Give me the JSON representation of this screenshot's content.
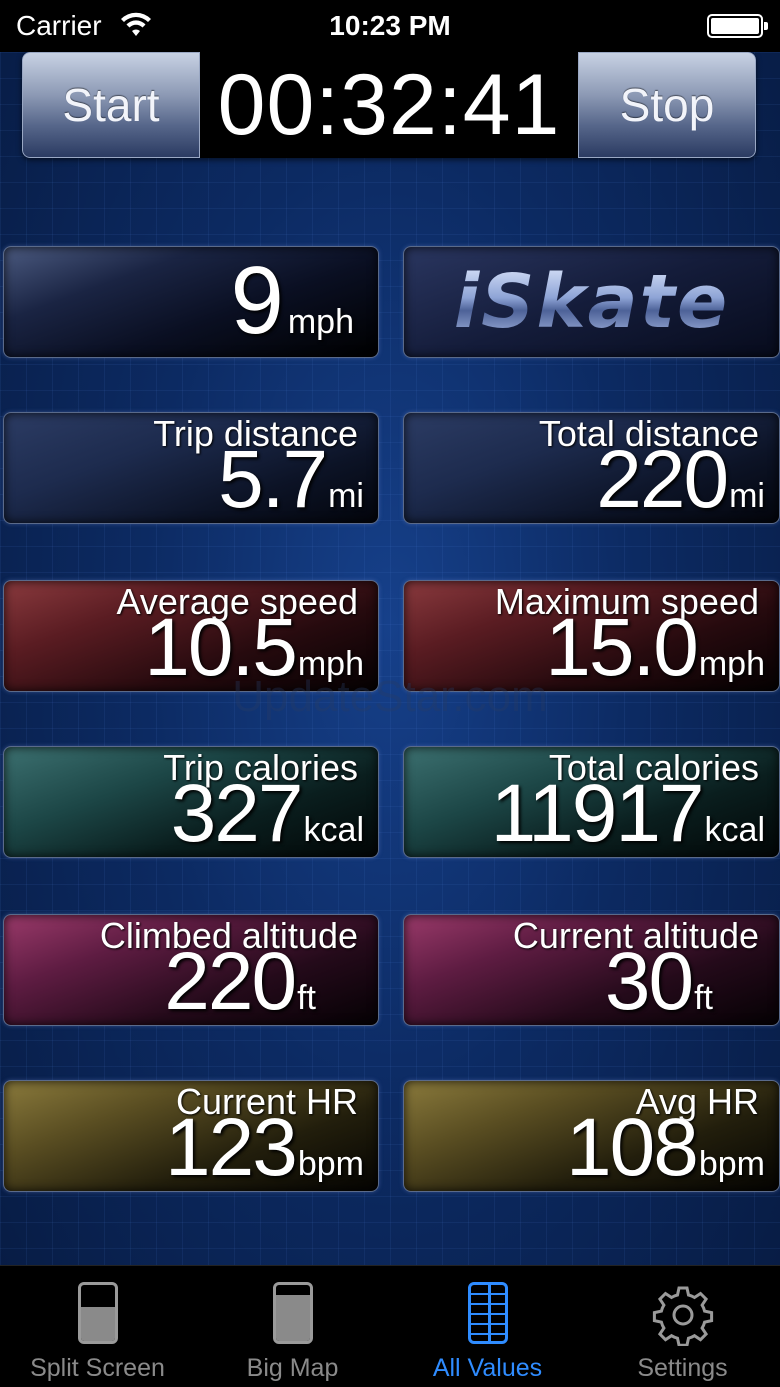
{
  "status_bar": {
    "carrier": "Carrier",
    "time": "10:23 PM"
  },
  "timer": {
    "start_label": "Start",
    "elapsed": "00:32:41",
    "stop_label": "Stop"
  },
  "speed": {
    "value": "9",
    "unit": "mph"
  },
  "logo": "iSkate",
  "watermark": "UpdateStar.com",
  "tiles": {
    "trip_distance": {
      "label": "Trip distance",
      "value": "5.7",
      "unit": "mi"
    },
    "total_distance": {
      "label": "Total distance",
      "value": "220",
      "unit": "mi"
    },
    "average_speed": {
      "label": "Average speed",
      "value": "10.5",
      "unit": "mph"
    },
    "maximum_speed": {
      "label": "Maximum speed",
      "value": "15.0",
      "unit": "mph"
    },
    "trip_calories": {
      "label": "Trip calories",
      "value": "327",
      "unit": "kcal"
    },
    "total_calories": {
      "label": "Total calories",
      "value": "11917",
      "unit": "kcal"
    },
    "climbed_altitude": {
      "label": "Climbed altitude",
      "value": "220",
      "unit": "ft"
    },
    "current_altitude": {
      "label": "Current altitude",
      "value": "30",
      "unit": "ft"
    },
    "current_hr": {
      "label": "Current HR",
      "value": "123",
      "unit": "bpm"
    },
    "avg_hr": {
      "label": "Avg HR",
      "value": "108",
      "unit": "bpm"
    }
  },
  "tab_bar": {
    "tabs": [
      {
        "label": "Split Screen",
        "icon": "split-screen-icon"
      },
      {
        "label": "Big Map",
        "icon": "big-map-icon"
      },
      {
        "label": "All Values",
        "icon": "all-values-icon",
        "active": true
      },
      {
        "label": "Settings",
        "icon": "gear-icon"
      }
    ]
  },
  "colors": {
    "active_tab": "#2f8cff",
    "inactive_tab": "#8a8a8a",
    "background": "#0c2a62"
  }
}
